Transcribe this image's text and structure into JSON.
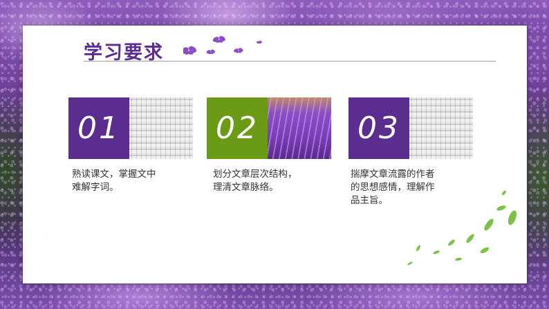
{
  "title": "学习要求",
  "colors": {
    "purple": "#5b2d8e",
    "green": "#6a9a16",
    "text": "#333333"
  },
  "items": [
    {
      "number": "01",
      "color": "#5b2d8e",
      "photo": "white-wisteria",
      "lines": [
        "熟读课文，掌握文中",
        "难解字词。"
      ]
    },
    {
      "number": "02",
      "color": "#6a9a16",
      "photo": "purple-wisteria",
      "lines": [
        "划分文章层次结构，",
        "理清文章脉络。"
      ]
    },
    {
      "number": "03",
      "color": "#5b2d8e",
      "photo": "white-wisteria",
      "lines": [
        "揣摩文章流露的作者",
        "的思想感情，理解作",
        "品主旨。"
      ]
    }
  ]
}
